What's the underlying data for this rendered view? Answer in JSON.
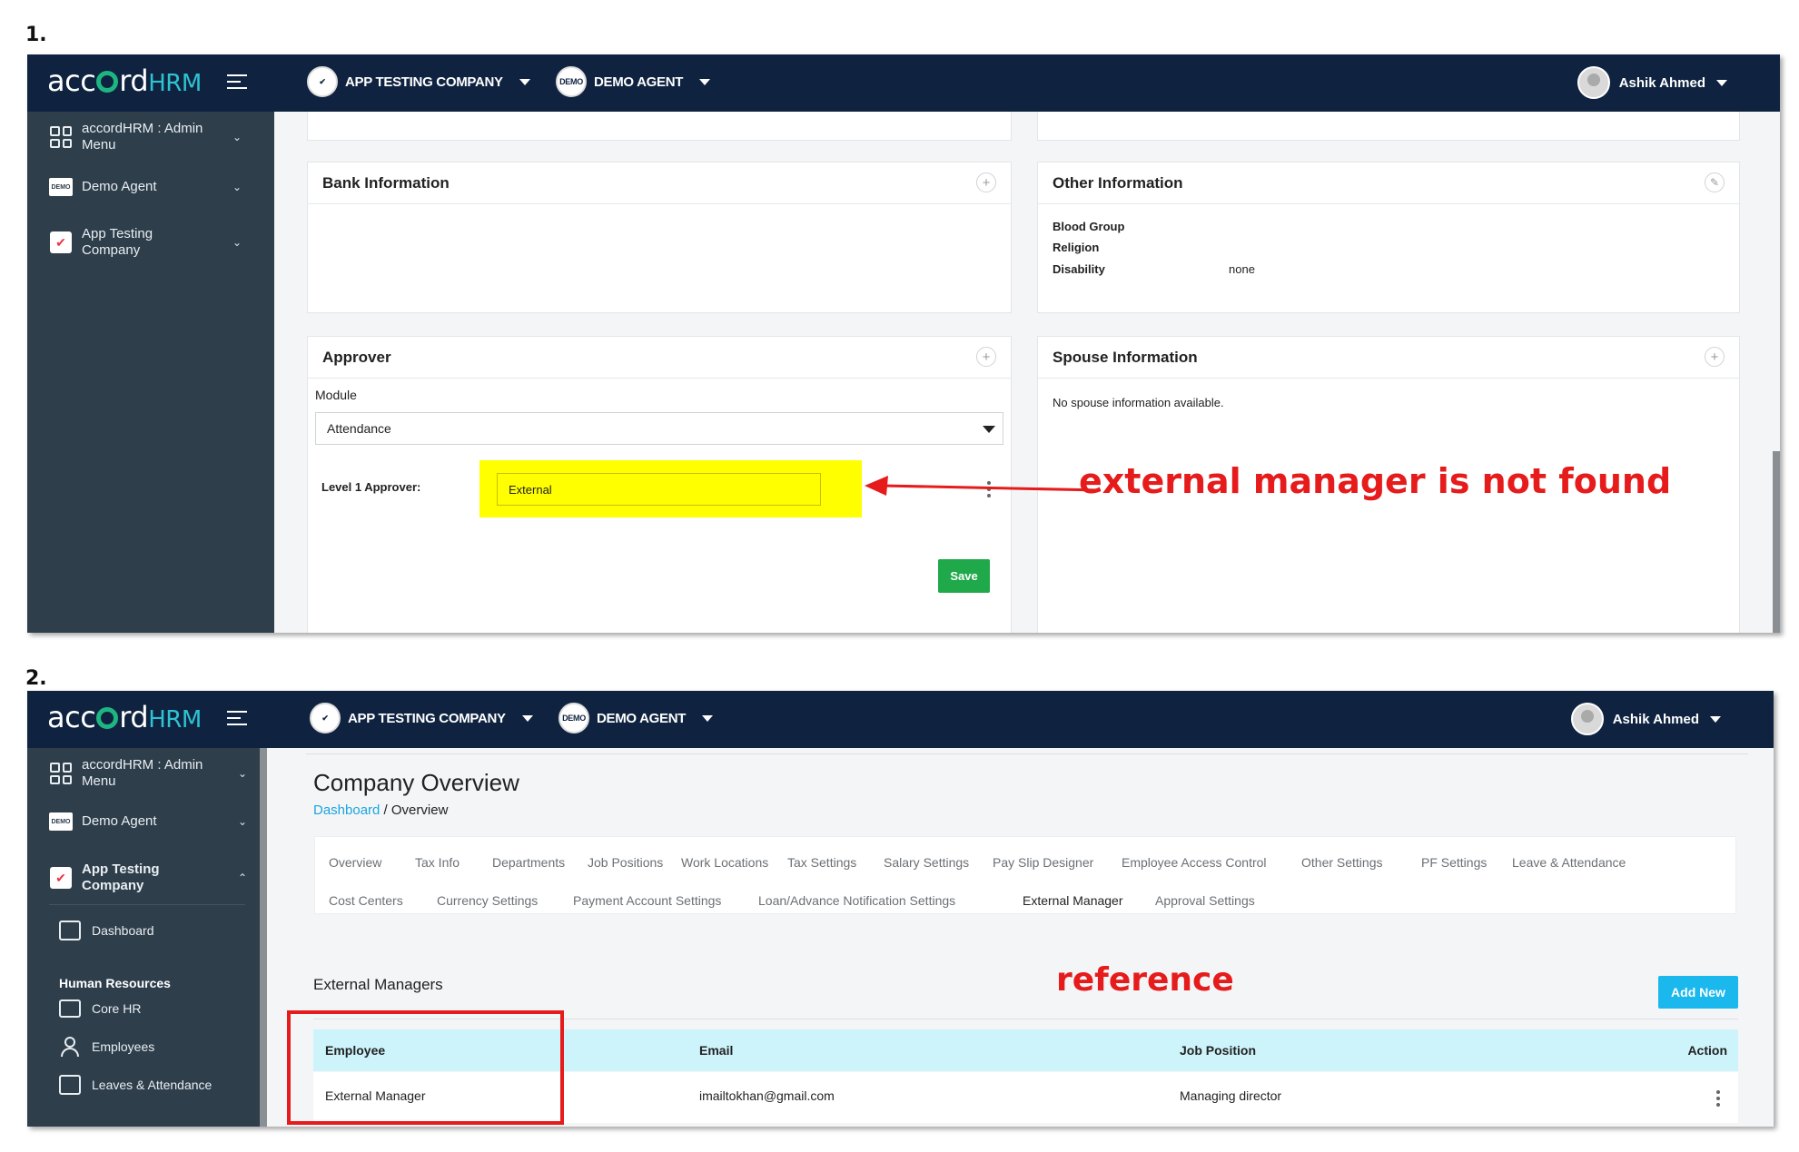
{
  "steps": [
    "1.",
    "2."
  ],
  "app": {
    "logo_main": "acc",
    "logo_rd": "rd",
    "logo_hrm": "HRM",
    "company_selector": "APP TESTING COMPANY",
    "agent_selector": "DEMO AGENT",
    "agent_logo_text": "DEMO",
    "user_name": "Ashik Ahmed"
  },
  "sidebar": {
    "admin_menu": "accordHRM : Admin Menu",
    "demo_agent": "Demo Agent",
    "app_testing_company": "App Testing Company",
    "dashboard": "Dashboard",
    "human_resources": "Human Resources",
    "core_hr": "Core HR",
    "employees": "Employees",
    "leaves_attendance": "Leaves & Attendance"
  },
  "screen1": {
    "bank_info_title": "Bank Information",
    "other_info_title": "Other Information",
    "other_info_fields": [
      {
        "label": "Blood Group",
        "value": ""
      },
      {
        "label": "Religion",
        "value": ""
      },
      {
        "label": "Disability",
        "value": "none"
      }
    ],
    "approver_title": "Approver",
    "module_label": "Module",
    "module_value": "Attendance",
    "level1_label": "Level 1 Approver:",
    "level1_value": "External",
    "save_button": "Save",
    "spouse_title": "Spouse Information",
    "spouse_empty": "No spouse information available.",
    "annotation": "external manager is not found"
  },
  "screen2": {
    "page_title": "Company Overview",
    "breadcrumb_link": "Dashboard",
    "breadcrumb_current": " / Overview",
    "tabs_row1": [
      "Overview",
      "Tax Info",
      "Departments",
      "Job Positions",
      "Work Locations",
      "Tax Settings",
      "Salary Settings",
      "Pay Slip Designer",
      "Employee Access Control",
      "Other Settings",
      "PF Settings",
      "Leave & Attendance"
    ],
    "tabs_row2": [
      "Cost Centers",
      "Currency Settings",
      "Payment Account Settings",
      "Loan/Advance Notification Settings",
      "External Manager",
      "Approval Settings"
    ],
    "active_tab": "External Manager",
    "section_title": "External Managers",
    "add_new_button": "Add New",
    "table_headers": [
      "Employee",
      "Email",
      "Job Position",
      "Action"
    ],
    "table_rows": [
      {
        "employee": "External Manager",
        "email": "imailtokhan@gmail.com",
        "job_position": "Managing director"
      }
    ],
    "annotation": "reference"
  },
  "colors": {
    "topbar": "#0f2340",
    "sidebar": "#2e3e4b",
    "highlight": "#ffff00",
    "annotation_red": "#e61b1b",
    "save_green": "#1fa94a",
    "add_new_blue": "#1ab8ec",
    "table_head": "#cdf3fb"
  }
}
